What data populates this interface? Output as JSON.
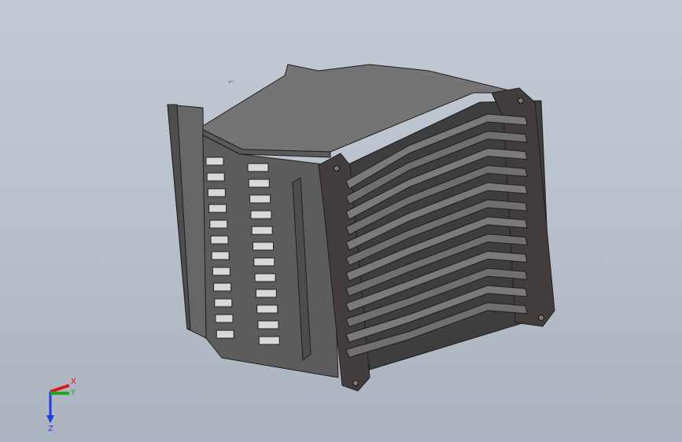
{
  "viewport": {
    "background_top": "#c3cad4",
    "background_bottom": "#aab3bf"
  },
  "model": {
    "description_icon": "heatsink-fin-3d-model-icon",
    "colors": {
      "face_light": "#727272",
      "face_mid": "#5e5e5e",
      "face_dark": "#4a4a4a",
      "edge": "#1e1e1e",
      "slot_fill": "#d8d8d8",
      "plate_dark": "#3d3838"
    },
    "fin_count": 12
  },
  "triad": {
    "x_label": "X",
    "y_label": "Y",
    "z_label": "Z",
    "x_color": "#d81b1b",
    "y_color": "#1fa51f",
    "z_color": "#1f3fd8"
  },
  "cursor_mark": "⌐"
}
